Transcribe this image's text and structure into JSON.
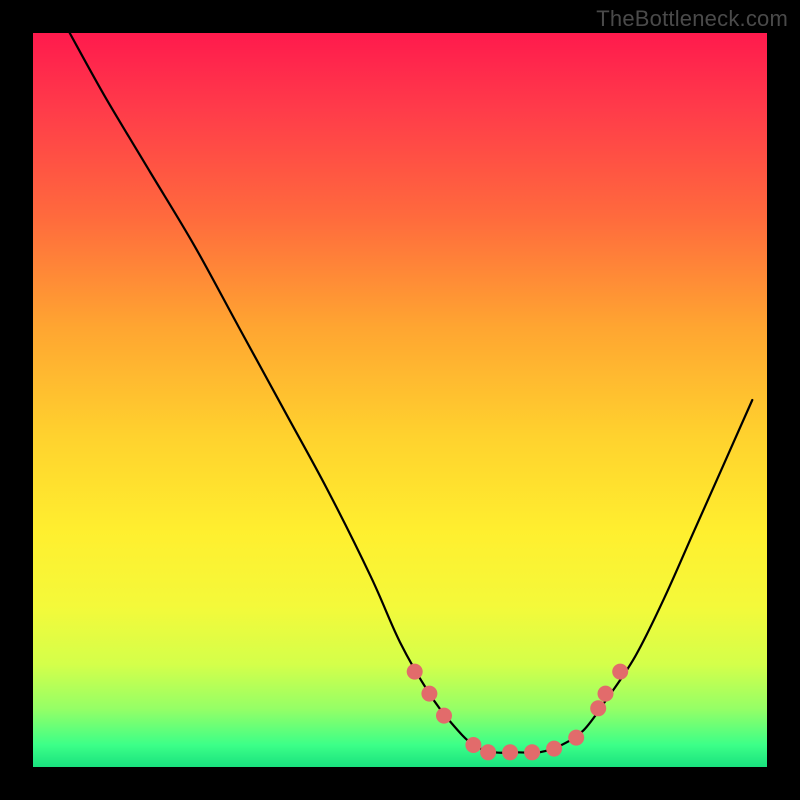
{
  "watermark": "TheBottleneck.com",
  "colors": {
    "gradient_top": "#ff1a4d",
    "gradient_mid": "#ffd22e",
    "gradient_bottom": "#19e27e",
    "curve": "#000000",
    "markers": "#e26b6b",
    "frame": "#000000"
  },
  "chart_data": {
    "type": "line",
    "title": "",
    "xlabel": "",
    "ylabel": "",
    "xlim": [
      0,
      100
    ],
    "ylim": [
      0,
      100
    ],
    "grid": false,
    "legend": false,
    "note": "Unlabeled bottleneck curve. x/y are percent of plot area (0 = left/bottom, 100 = right/top). Values estimated from pixels.",
    "series": [
      {
        "name": "curve",
        "x": [
          5,
          10,
          16,
          22,
          28,
          34,
          40,
          46,
          50,
          54,
          57,
          60,
          63,
          66,
          69,
          72,
          75,
          78,
          82,
          86,
          90,
          94,
          98
        ],
        "y": [
          100,
          91,
          81,
          71,
          60,
          49,
          38,
          26,
          17,
          10,
          6,
          3,
          2,
          2,
          2,
          3,
          5,
          9,
          15,
          23,
          32,
          41,
          50
        ]
      }
    ],
    "markers": {
      "name": "highlighted-points",
      "x": [
        52,
        54,
        56,
        60,
        62,
        65,
        68,
        71,
        74,
        77,
        78,
        80
      ],
      "y": [
        13,
        10,
        7,
        3,
        2,
        2,
        2,
        2.5,
        4,
        8,
        10,
        13
      ]
    }
  }
}
